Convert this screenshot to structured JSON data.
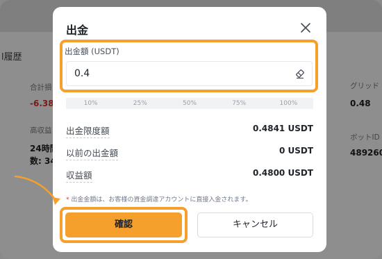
{
  "background": {
    "section_title": "l履歴",
    "total_label": "合計損",
    "total_value": "-6.38",
    "high_label": "高収益",
    "hours_label": "24時間",
    "count_label": "数: 34",
    "grid_label": "グリッド",
    "grid_value": "0.48",
    "bot_id_label": "ボットID",
    "bot_id_value": "489260"
  },
  "modal": {
    "title": "出金",
    "amount": {
      "label": "出金額 (USDT)",
      "value": "0.4"
    },
    "percentages": [
      "10%",
      "25%",
      "50%",
      "75%",
      "100%"
    ],
    "rows": [
      {
        "label": "出金限度額",
        "value": "0.4841 USDT"
      },
      {
        "label": "以前の出金額",
        "value": "0 USDT"
      },
      {
        "label": "収益額",
        "value": "0.4800 USDT"
      }
    ],
    "note_star": "*",
    "note": "出金金額は、お客様の資金調達アカウントに直接入金されます。",
    "confirm_label": "確認",
    "cancel_label": "キャンセル"
  },
  "colors": {
    "accent": "#f5a02d",
    "overlay": "#8c8c8c"
  },
  "icons": [
    "close-icon",
    "eraser-icon",
    "annotation-arrow-icon"
  ]
}
